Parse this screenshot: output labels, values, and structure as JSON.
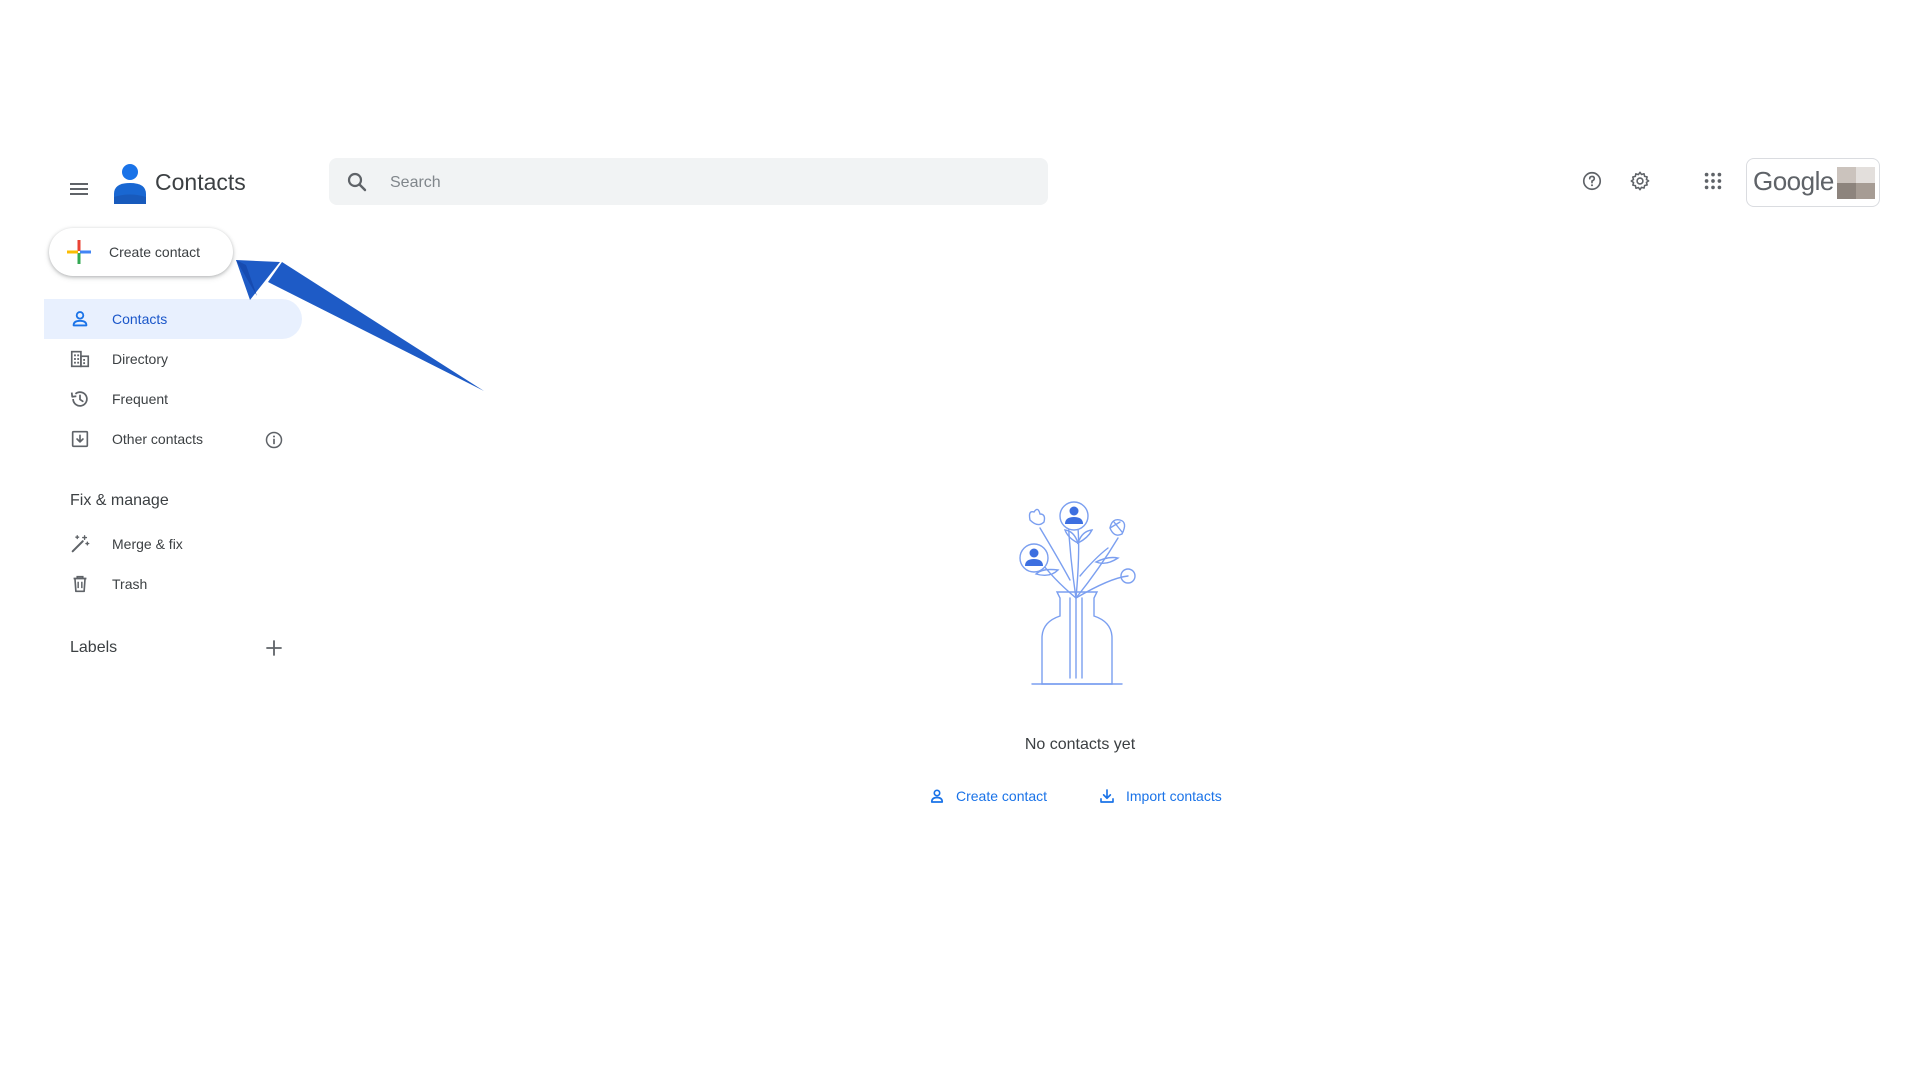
{
  "header": {
    "menu_icon": "menu-icon",
    "app_title": "Contacts",
    "search": {
      "placeholder": "Search",
      "value": ""
    },
    "help_icon": "help-icon",
    "settings_icon": "gear-icon",
    "apps_icon": "apps-grid-icon",
    "account_brand": "Google"
  },
  "sidebar": {
    "create_button": {
      "label": "Create contact",
      "icon": "plus-icon"
    },
    "items": [
      {
        "label": "Contacts",
        "icon": "person-icon",
        "active": true
      },
      {
        "label": "Directory",
        "icon": "building-icon",
        "active": false
      },
      {
        "label": "Frequent",
        "icon": "history-icon",
        "active": false
      },
      {
        "label": "Other contacts",
        "icon": "archive-icon",
        "active": false,
        "info_icon": "info-icon"
      }
    ],
    "fix_manage": {
      "heading": "Fix & manage",
      "items": [
        {
          "label": "Merge & fix",
          "icon": "magic-wand-icon"
        },
        {
          "label": "Trash",
          "icon": "trash-icon"
        }
      ]
    },
    "labels": {
      "heading": "Labels",
      "add_icon": "plus-icon"
    }
  },
  "main": {
    "empty_state": {
      "message": "No contacts yet",
      "actions": [
        {
          "label": "Create contact",
          "icon": "person-add-icon"
        },
        {
          "label": "Import contacts",
          "icon": "download-icon"
        }
      ]
    }
  },
  "colors": {
    "accent": "#1a73e8",
    "active_bg": "#e8f0fe",
    "search_bg": "#f1f3f4",
    "annotation_arrow": "#1e5bc6"
  }
}
